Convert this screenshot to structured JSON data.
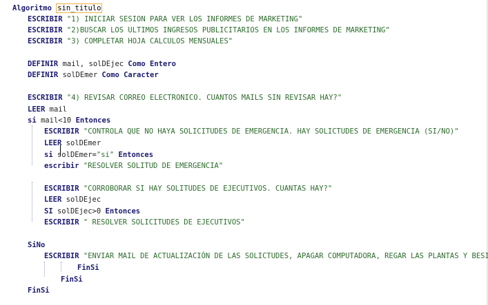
{
  "editor": {
    "lines": [
      {
        "id": "algoritmo",
        "tokens": [
          {
            "t": "Algoritmo",
            "c": "kw"
          },
          {
            "t": " ",
            "c": "txt"
          },
          {
            "t": "sin_titulo",
            "c": "ident"
          }
        ]
      },
      {
        "id": "escribir-1",
        "tokens": [
          {
            "t": "ESCRIBIR",
            "c": "kw"
          },
          {
            "t": " \"1) INICIAR SESION PARA VER LOS INFORMES DE MARKETING\"",
            "c": "str"
          }
        ]
      },
      {
        "id": "escribir-2",
        "tokens": [
          {
            "t": "ESCRIBIR",
            "c": "kw"
          },
          {
            "t": " \"2)BUSCAR LOS ULTIMOS INGRESOS PUBLICITARIOS EN LOS INFORMES DE MARKETING\"",
            "c": "str"
          }
        ]
      },
      {
        "id": "escribir-3",
        "tokens": [
          {
            "t": "ESCRIBIR",
            "c": "kw"
          },
          {
            "t": " \"3) COMPLETAR HOJA CALCULOS MENSUALES\"",
            "c": "str"
          }
        ]
      },
      {
        "id": "definir-1",
        "tokens": [
          {
            "t": "DEFINIR",
            "c": "kw"
          },
          {
            "t": " mail, solDEjec ",
            "c": "txt"
          },
          {
            "t": "Como Entero",
            "c": "kw"
          }
        ]
      },
      {
        "id": "definir-2",
        "tokens": [
          {
            "t": "DEFINIR",
            "c": "kw"
          },
          {
            "t": " solDEmer ",
            "c": "txt"
          },
          {
            "t": "Como Caracter",
            "c": "kw"
          }
        ]
      },
      {
        "id": "escribir-4",
        "tokens": [
          {
            "t": "ESCRIBIR",
            "c": "kw"
          },
          {
            "t": " \"4) REVISAR CORREO ELECTRONICO. CUANTOS MAILS SIN REVISAR HAY?\"",
            "c": "str"
          }
        ]
      },
      {
        "id": "leer-mail",
        "tokens": [
          {
            "t": "LEER",
            "c": "kw"
          },
          {
            "t": " mail",
            "c": "txt"
          }
        ]
      },
      {
        "id": "si-mail",
        "tokens": [
          {
            "t": "si",
            "c": "kw"
          },
          {
            "t": " mail<",
            "c": "txt"
          },
          {
            "t": "10",
            "c": "num"
          },
          {
            "t": " ",
            "c": "txt"
          },
          {
            "t": "Entonces",
            "c": "kw"
          }
        ]
      },
      {
        "id": "escribir-emergencia",
        "tokens": [
          {
            "t": "ESCRIBIR",
            "c": "kw"
          },
          {
            "t": " \"CONTROLA QUE NO HAYA SOLICITUDES DE EMERGENCIA. HAY SOLICTUDES DE EMERGENCIA (SI/NO)\"",
            "c": "str"
          }
        ]
      },
      {
        "id": "leer-soldemer",
        "tokens": [
          {
            "t": "LEER",
            "c": "kw"
          },
          {
            "t": " solDEmer",
            "c": "txt"
          }
        ]
      },
      {
        "id": "si-soldemer",
        "tokens": [
          {
            "t": "si",
            "c": "kw"
          },
          {
            "t": " solDEmer=",
            "c": "txt"
          },
          {
            "t": "\"si\"",
            "c": "str"
          },
          {
            "t": " ",
            "c": "txt"
          },
          {
            "t": "Entonces",
            "c": "kw"
          }
        ]
      },
      {
        "id": "escribir-resolver",
        "tokens": [
          {
            "t": "escribir",
            "c": "kw"
          },
          {
            "t": " \"RESOLVER SOLITUD DE EMERGENCIA\"",
            "c": "str"
          }
        ]
      },
      {
        "id": "escribir-corroborar",
        "tokens": [
          {
            "t": "ESCRIBIR",
            "c": "kw"
          },
          {
            "t": " \"CORROBORAR SI HAY SOLITUDES DE EJECUTIVOS. CUANTAS HAY?\"",
            "c": "str"
          }
        ]
      },
      {
        "id": "leer-soldejec",
        "tokens": [
          {
            "t": "LEER",
            "c": "kw"
          },
          {
            "t": " solDEjec",
            "c": "txt"
          }
        ]
      },
      {
        "id": "si-soldejec",
        "tokens": [
          {
            "t": "SI",
            "c": "kw"
          },
          {
            "t": " solDEjec>",
            "c": "txt"
          },
          {
            "t": "0",
            "c": "num"
          },
          {
            "t": " ",
            "c": "txt"
          },
          {
            "t": "Entonces",
            "c": "kw"
          }
        ]
      },
      {
        "id": "escribir-ejecutivos",
        "tokens": [
          {
            "t": "ESCRIBIR",
            "c": "kw"
          },
          {
            "t": " \" RESOLVER SOLICITUDES DE EJECUTIVOS\"",
            "c": "str"
          }
        ]
      },
      {
        "id": "sino",
        "tokens": [
          {
            "t": "SiNo",
            "c": "kw"
          }
        ]
      },
      {
        "id": "escribir-enviar",
        "tokens": [
          {
            "t": "ESCRIBIR",
            "c": "kw"
          },
          {
            "t": " \"ENVIAR MAIL DE ACTUALIZACIÓN DE LAS SOLICTUDES, APAGAR COMPUTADORA, REGAR LAS PLANTAS Y BESIS\"",
            "c": "str"
          }
        ]
      },
      {
        "id": "finsi-3",
        "tokens": [
          {
            "t": "FinSi",
            "c": "kw"
          }
        ]
      },
      {
        "id": "finsi-2",
        "tokens": [
          {
            "t": "FinSi",
            "c": "kw"
          }
        ]
      },
      {
        "id": "finsi-1",
        "tokens": [
          {
            "t": "FinSi",
            "c": "kw"
          }
        ]
      }
    ]
  }
}
